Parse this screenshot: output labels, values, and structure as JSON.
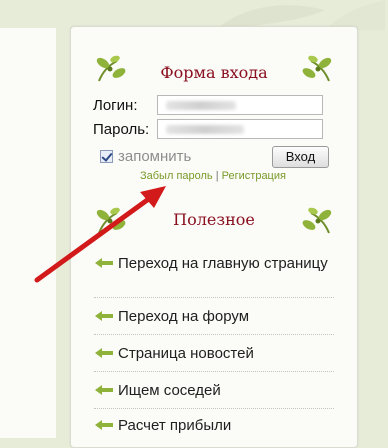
{
  "login_form": {
    "title": "Форма входа",
    "login_label": "Логин:",
    "password_label": "Пароль:",
    "remember_label": "запомнить",
    "remember_checked": true,
    "submit_label": "Вход",
    "forgot_link": "Забыл пароль",
    "link_separator": "|",
    "register_link": "Регистрация"
  },
  "useful": {
    "title": "Полезное",
    "items": [
      {
        "label": "Переход на главную страницу"
      },
      {
        "label": "Переход на форум"
      },
      {
        "label": "Страница новостей"
      },
      {
        "label": "Ищем соседей"
      },
      {
        "label": "Расчет прибыли"
      }
    ]
  },
  "colors": {
    "title": "#8a1020",
    "accent_green": "#7a9a2a",
    "arrow": "#d21a1a"
  }
}
